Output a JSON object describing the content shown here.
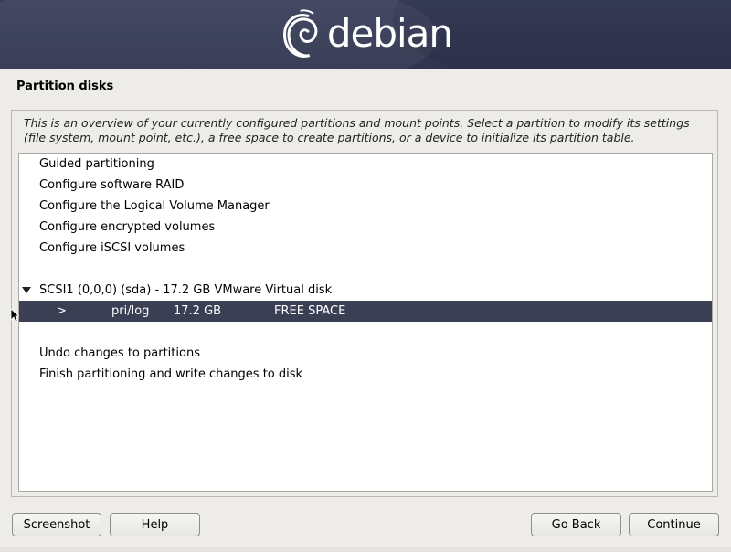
{
  "header": {
    "logo_text": "debian"
  },
  "page_title": "Partition disks",
  "description": "This is an overview of your currently configured partitions and mount points. Select a partition to modify its settings (file system, mount point, etc.), a free space to create partitions, or a device to initialize its partition table.",
  "menu": {
    "items": [
      "Guided partitioning",
      "Configure software RAID",
      "Configure the Logical Volume Manager",
      "Configure encrypted volumes",
      "Configure iSCSI volumes"
    ],
    "disk": {
      "label": "SCSI1 (0,0,0) (sda) - 17.2 GB VMware Virtual disk",
      "partition": {
        "marker": ">",
        "type": "pri/log",
        "size": "17.2 GB",
        "status": "FREE SPACE"
      }
    },
    "actions": [
      "Undo changes to partitions",
      "Finish partitioning and write changes to disk"
    ]
  },
  "buttons": {
    "screenshot": "Screenshot",
    "help": "Help",
    "go_back": "Go Back",
    "continue": "Continue"
  },
  "colors": {
    "banner": "#3a3f5c",
    "selection": "#3a3f54",
    "background": "#edece8"
  }
}
